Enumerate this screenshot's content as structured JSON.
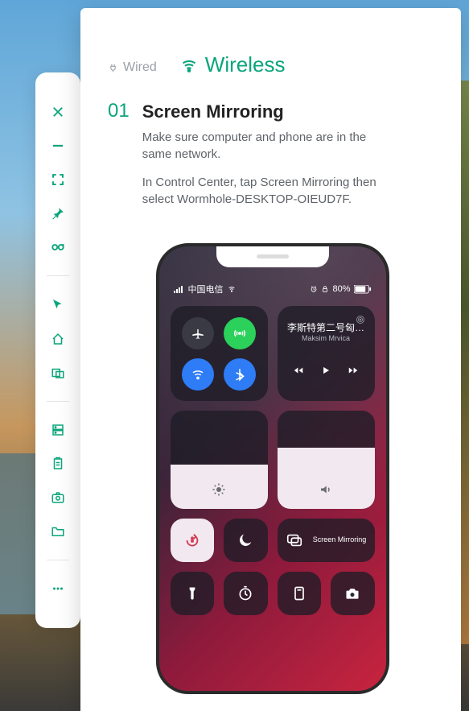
{
  "sidebar": {
    "items": [
      {
        "name": "close"
      },
      {
        "name": "minimize"
      },
      {
        "name": "fullscreen"
      },
      {
        "name": "pin"
      },
      {
        "name": "link"
      },
      {
        "sep": true
      },
      {
        "name": "cursor"
      },
      {
        "name": "home"
      },
      {
        "name": "multitask"
      },
      {
        "sep": true
      },
      {
        "name": "server"
      },
      {
        "name": "clipboard"
      },
      {
        "name": "camera"
      },
      {
        "name": "folder"
      },
      {
        "sep": true
      },
      {
        "name": "more"
      }
    ]
  },
  "tabs": {
    "wired": "Wired",
    "wireless": "Wireless"
  },
  "step": {
    "number": "01",
    "title": "Screen Mirroring",
    "para1": "Make sure computer and phone are in the same network.",
    "para2": "In Control Center, tap Screen Mirroring then select Wormhole-DESKTOP-OIEUD7F."
  },
  "phone": {
    "status": {
      "left": "中国电信",
      "right_alarm": "⏰",
      "right_lock": "🔒",
      "battery": "80%"
    },
    "music": {
      "title": "李斯特第二号匈…",
      "artist": "Maksim Mrvica"
    },
    "mirror_label": "Screen Mirroring",
    "brightness_pct": 45,
    "volume_pct": 62
  }
}
